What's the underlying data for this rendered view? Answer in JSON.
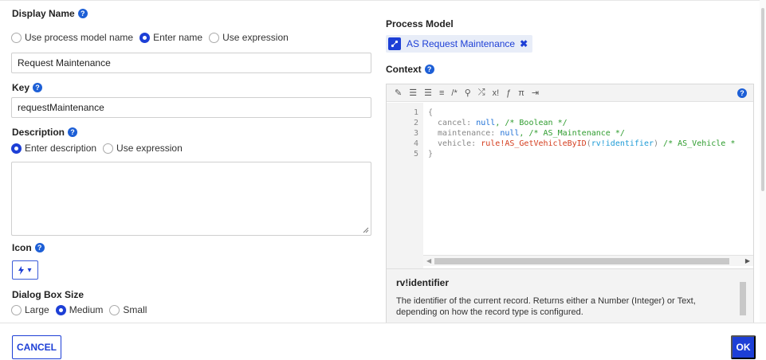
{
  "display_name": {
    "label": "Display Name",
    "options": [
      "Use process model name",
      "Enter name",
      "Use expression"
    ],
    "selected_index": 1,
    "value": "Request Maintenance"
  },
  "key": {
    "label": "Key",
    "value": "requestMaintenance"
  },
  "description": {
    "label": "Description",
    "options": [
      "Enter description",
      "Use expression"
    ],
    "selected_index": 0,
    "value": ""
  },
  "icon": {
    "label": "Icon",
    "selected_icon": "lightning-icon"
  },
  "dialog_box_size": {
    "label": "Dialog Box Size",
    "options": [
      "Large",
      "Medium",
      "Small"
    ],
    "selected_index": 1
  },
  "process_model": {
    "label": "Process Model",
    "value": "AS Request Maintenance"
  },
  "context": {
    "label": "Context",
    "toolbar_icons": [
      "magic-wand-icon",
      "indent-icon",
      "outdent-icon",
      "list-icon",
      "comment-icon",
      "search-icon",
      "shuffle-icon",
      "variable-icon",
      "function-icon",
      "pi-icon",
      "export-icon"
    ],
    "code": {
      "line_numbers": [
        "1",
        "2",
        "3",
        "4",
        "5"
      ],
      "line1": "{",
      "l2_key": "  cancel: ",
      "l2_val": "null",
      "l2_comment": ", /* Boolean */",
      "l3_key": "  maintenance: ",
      "l3_val": "null",
      "l3_comment": ", /* AS_Maintenance */",
      "l4_key": "  vehicle: ",
      "l4_fn": "rule!AS_GetVehicleByID",
      "l4_open": "(",
      "l4_arg": "rv!identifier",
      "l4_close": ") ",
      "l4_comment": "/* AS_Vehicle *",
      "line5": "}"
    },
    "doc_title": "rv!identifier",
    "doc_body": "The identifier of the current record. Returns either a Number (Integer) or Text, depending on how the record type is configured."
  },
  "footer": {
    "cancel_label": "CANCEL",
    "ok_label": "OK"
  },
  "colors": {
    "accent": "#1d3fd6",
    "keyword": "#1d6fd6",
    "comment": "#2e9c2e",
    "rule": "#d43c1d"
  }
}
